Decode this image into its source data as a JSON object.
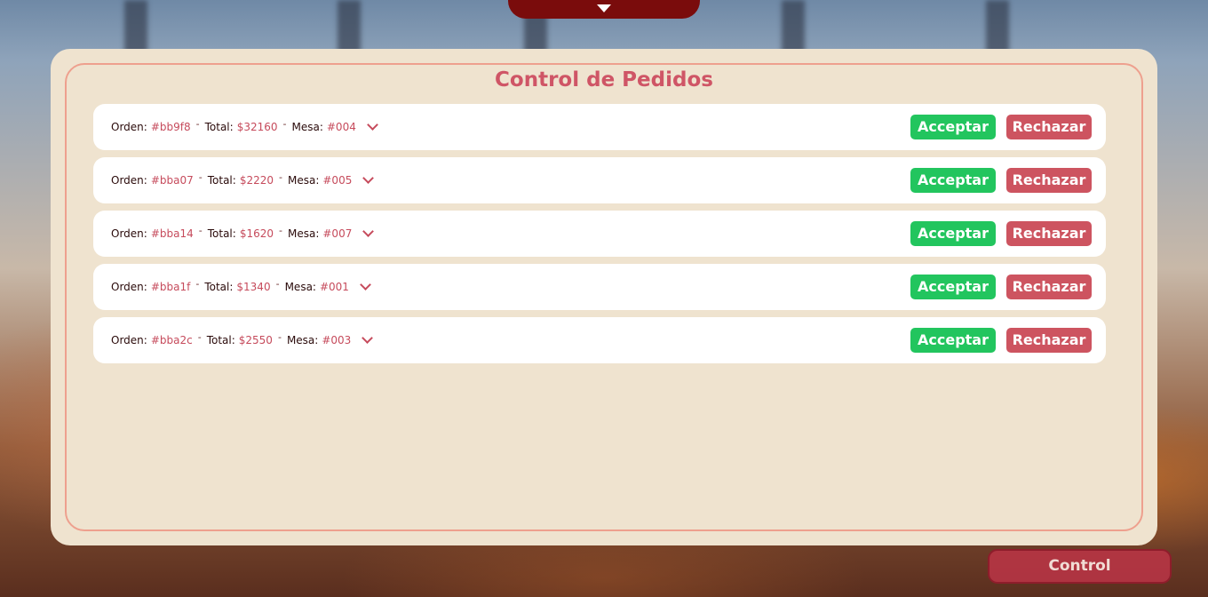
{
  "header": {
    "toggle_icon": "caret-down-icon"
  },
  "panel": {
    "title": "Control de Pedidos"
  },
  "labels": {
    "order": "Orden:",
    "total": "Total:",
    "table": "Mesa:",
    "separator": "-",
    "accept": "Acceptar",
    "reject": "Rechazar",
    "expand_icon": "chevron-down-icon"
  },
  "orders": [
    {
      "id": "#bb9f8",
      "total": "$32160",
      "table": "#004"
    },
    {
      "id": "#bba07",
      "total": "$2220",
      "table": "#005"
    },
    {
      "id": "#bba14",
      "total": "$1620",
      "table": "#007"
    },
    {
      "id": "#bba1f",
      "total": "$1340",
      "table": "#001"
    },
    {
      "id": "#bba2c",
      "total": "$2550",
      "table": "#003"
    }
  ],
  "footer": {
    "control_label": "Control"
  },
  "colors": {
    "accent": "#cf5566",
    "accept": "#22c55e",
    "reject": "#cd5460",
    "panel_bg": "#efe3cf",
    "tab_bg": "#7a0c0c"
  }
}
